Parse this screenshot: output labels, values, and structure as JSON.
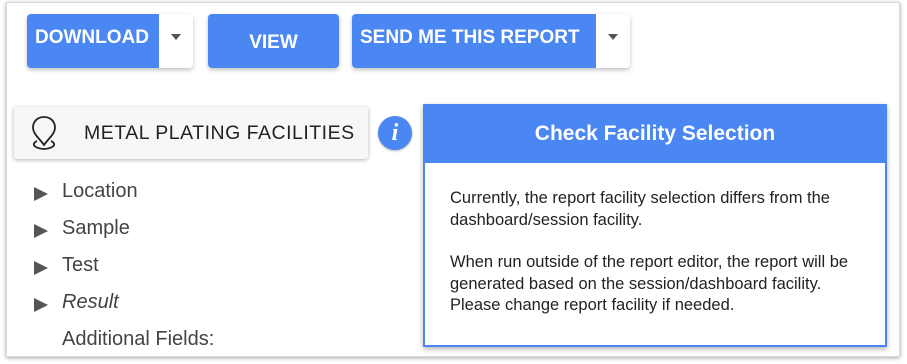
{
  "toolbar": {
    "download_label": "DOWNLOAD",
    "view_label": "VIEW",
    "send_label": "SEND ME THIS REPORT"
  },
  "facility": {
    "label": "METAL PLATING FACILITIES",
    "icon": "location-pin-icon"
  },
  "info": {
    "glyph": "i",
    "icon": "info-icon"
  },
  "tree": {
    "items": [
      {
        "label": "Location"
      },
      {
        "label": "Sample"
      },
      {
        "label": "Test"
      },
      {
        "label": "Result"
      }
    ],
    "additional_fields": "Additional Fields:"
  },
  "popup": {
    "title": "Check Facility Selection",
    "paragraph1": "Currently, the report facility selection differs from the dashboard/session facility.",
    "paragraph2": "When run outside of the report editor, the report will be generated based on the session/dashboard facility. Please change report facility if needed."
  },
  "colors": {
    "accent": "#4a87f3",
    "text": "#444444"
  }
}
